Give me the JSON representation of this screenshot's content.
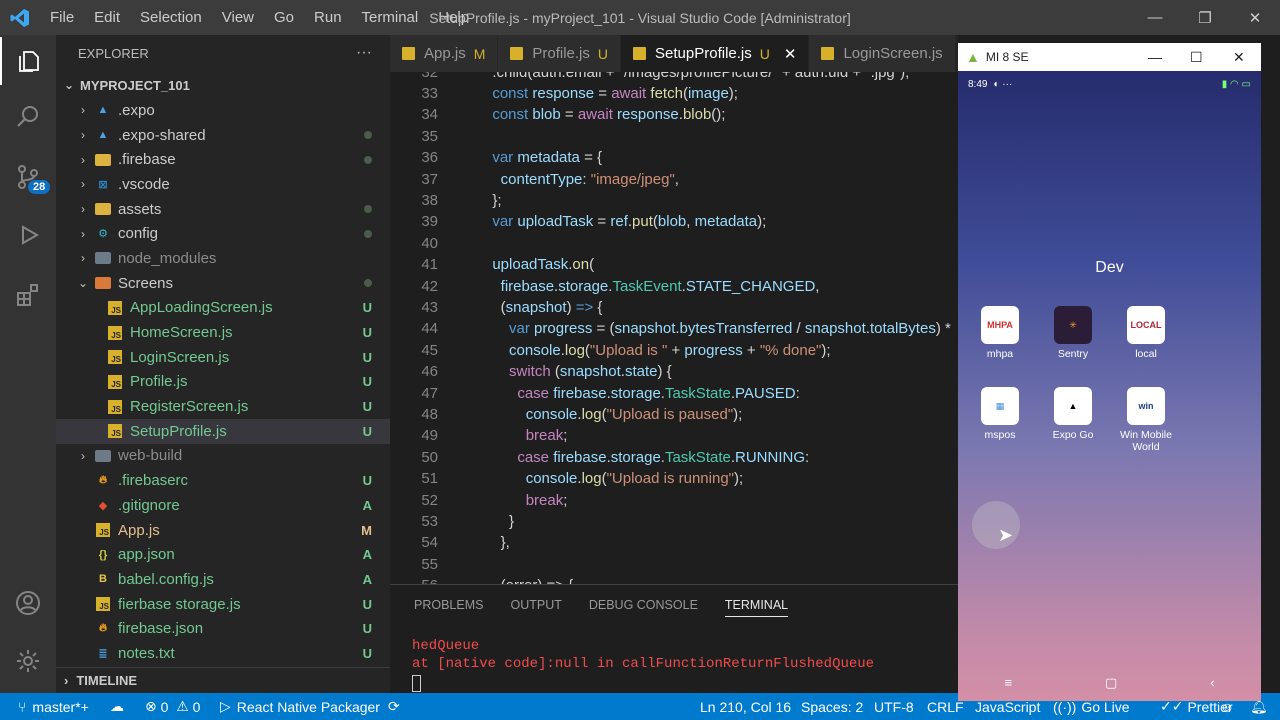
{
  "window": {
    "title": "SetupProfile.js - myProject_101 - Visual Studio Code [Administrator]"
  },
  "menu": [
    "File",
    "Edit",
    "Selection",
    "View",
    "Go",
    "Run",
    "Terminal",
    "Help"
  ],
  "activity": {
    "scm_badge": "28"
  },
  "explorer": {
    "header": "EXPLORER",
    "more": "···",
    "project": "MYPROJECT_101",
    "timeline": "TIMELINE",
    "items": [
      {
        "name": ".expo",
        "status": "",
        "icon": "expo",
        "depth": 1,
        "chev": "›"
      },
      {
        "name": ".expo-shared",
        "status": "dot",
        "icon": "expo",
        "depth": 1,
        "chev": "›"
      },
      {
        "name": ".firebase",
        "status": "dot",
        "icon": "folder-y",
        "depth": 1,
        "chev": "›"
      },
      {
        "name": ".vscode",
        "status": "",
        "icon": "vscode",
        "depth": 1,
        "chev": "›"
      },
      {
        "name": "assets",
        "status": "dot",
        "icon": "folder-y",
        "depth": 1,
        "chev": "›"
      },
      {
        "name": "config",
        "status": "dot",
        "icon": "config",
        "depth": 1,
        "chev": "›"
      },
      {
        "name": "node_modules",
        "status": "",
        "icon": "folder-g",
        "depth": 1,
        "chev": "›"
      },
      {
        "name": "Screens",
        "status": "dot",
        "icon": "folder-o",
        "depth": 1,
        "chev": "⌄"
      },
      {
        "name": "AppLoadingScreen.js",
        "status": "U",
        "icon": "js",
        "depth": 2,
        "chev": ""
      },
      {
        "name": "HomeScreen.js",
        "status": "U",
        "icon": "js",
        "depth": 2,
        "chev": ""
      },
      {
        "name": "LoginScreen.js",
        "status": "U",
        "icon": "js",
        "depth": 2,
        "chev": ""
      },
      {
        "name": "Profile.js",
        "status": "U",
        "icon": "js",
        "depth": 2,
        "chev": ""
      },
      {
        "name": "RegisterScreen.js",
        "status": "U",
        "icon": "js",
        "depth": 2,
        "chev": ""
      },
      {
        "name": "SetupProfile.js",
        "status": "U",
        "icon": "js",
        "depth": 2,
        "chev": "",
        "selected": true
      },
      {
        "name": "web-build",
        "status": "",
        "icon": "folder-g",
        "depth": 1,
        "chev": "›"
      },
      {
        "name": ".firebaserc",
        "status": "U",
        "icon": "fire",
        "depth": 1,
        "chev": ""
      },
      {
        "name": ".gitignore",
        "status": "A",
        "icon": "git",
        "depth": 1,
        "chev": ""
      },
      {
        "name": "App.js",
        "status": "M",
        "icon": "js",
        "depth": 1,
        "chev": ""
      },
      {
        "name": "app.json",
        "status": "A",
        "icon": "json",
        "depth": 1,
        "chev": ""
      },
      {
        "name": "babel.config.js",
        "status": "A",
        "icon": "babel",
        "depth": 1,
        "chev": ""
      },
      {
        "name": "fierbase storage.js",
        "status": "U",
        "icon": "js",
        "depth": 1,
        "chev": ""
      },
      {
        "name": "firebase.json",
        "status": "U",
        "icon": "fire",
        "depth": 1,
        "chev": ""
      },
      {
        "name": "notes.txt",
        "status": "U",
        "icon": "txt",
        "depth": 1,
        "chev": ""
      }
    ]
  },
  "tabs": [
    {
      "label": "App.js",
      "mod": "M",
      "active": false
    },
    {
      "label": "Profile.js",
      "mod": "U",
      "active": false
    },
    {
      "label": "SetupProfile.js",
      "mod": "U",
      "active": true,
      "close": "✕"
    },
    {
      "label": "LoginScreen.js",
      "mod": "",
      "active": false
    }
  ],
  "code": {
    "partial_top": "  .child(auth.email + \"/images/profilePicture/\" + auth.uid + \".jpg\");",
    "lines": [
      {
        "n": "33",
        "html": "  <span class='kw'>const</span> <span class='vr'>response</span> = <span class='k2'>await</span> <span class='fn'>fetch</span>(<span class='vr'>image</span>);"
      },
      {
        "n": "34",
        "html": "  <span class='kw'>const</span> <span class='vr'>blob</span> = <span class='k2'>await</span> <span class='vr'>response</span>.<span class='fn'>blob</span>();"
      },
      {
        "n": "35",
        "html": ""
      },
      {
        "n": "36",
        "html": "  <span class='kw'>var</span> <span class='vr'>metadata</span> = {"
      },
      {
        "n": "37",
        "html": "    <span class='vr'>contentType</span>: <span class='str'>\"image/jpeg\"</span>,"
      },
      {
        "n": "38",
        "html": "  };"
      },
      {
        "n": "39",
        "html": "  <span class='kw'>var</span> <span class='vr'>uploadTask</span> = <span class='vr'>ref</span>.<span class='fn'>put</span>(<span class='vr'>blob</span>, <span class='vr'>metadata</span>);"
      },
      {
        "n": "40",
        "html": ""
      },
      {
        "n": "41",
        "html": "  <span class='vr'>uploadTask</span>.<span class='fn'>on</span>("
      },
      {
        "n": "42",
        "html": "    <span class='vr'>firebase</span>.<span class='vr'>storage</span>.<span class='ty'>TaskEvent</span>.<span class='vr'>STATE_CHANGED</span>,"
      },
      {
        "n": "43",
        "html": "    (<span class='vr'>snapshot</span>) <span class='kw'>=&gt;</span> {"
      },
      {
        "n": "44",
        "html": "      <span class='kw'>var</span> <span class='vr'>progress</span> = (<span class='vr'>snapshot</span>.<span class='vr'>bytesTransferred</span> / <span class='vr'>snapshot</span>.<span class='vr'>totalBytes</span>) *"
      },
      {
        "n": "45",
        "html": "      <span class='vr'>console</span>.<span class='fn'>log</span>(<span class='str'>\"Upload is \"</span> + <span class='vr'>progress</span> + <span class='str'>\"% done\"</span>);"
      },
      {
        "n": "46",
        "html": "      <span class='k2'>switch</span> (<span class='vr'>snapshot</span>.<span class='vr'>state</span>) {"
      },
      {
        "n": "47",
        "html": "        <span class='k2'>case</span> <span class='vr'>firebase</span>.<span class='vr'>storage</span>.<span class='ty'>TaskState</span>.<span class='vr'>PAUSED</span>:"
      },
      {
        "n": "48",
        "html": "          <span class='vr'>console</span>.<span class='fn'>log</span>(<span class='str'>\"Upload is paused\"</span>);"
      },
      {
        "n": "49",
        "html": "          <span class='k2'>break</span>;"
      },
      {
        "n": "50",
        "html": "        <span class='k2'>case</span> <span class='vr'>firebase</span>.<span class='vr'>storage</span>.<span class='ty'>TaskState</span>.<span class='vr'>RUNNING</span>:"
      },
      {
        "n": "51",
        "html": "          <span class='vr'>console</span>.<span class='fn'>log</span>(<span class='str'>\"Upload is running\"</span>);"
      },
      {
        "n": "52",
        "html": "          <span class='k2'>break</span>;"
      },
      {
        "n": "53",
        "html": "      }"
      },
      {
        "n": "54",
        "html": "    },"
      },
      {
        "n": "55",
        "html": ""
      }
    ]
  },
  "panel": {
    "tabs": [
      "PROBLEMS",
      "OUTPUT",
      "DEBUG CONSOLE",
      "TERMINAL"
    ],
    "active": "TERMINAL",
    "terminal": [
      "hedQueue",
      "at [native code]:null in callFunctionReturnFlushedQueue"
    ]
  },
  "status": {
    "branch": "master*+",
    "errors": "0",
    "warnings": "0",
    "packager": "React Native Packager",
    "position": "Ln 210, Col 16",
    "spaces": "Spaces: 2",
    "encoding": "UTF-8",
    "eol": "CRLF",
    "language": "JavaScript",
    "golive": "Go Live",
    "prettier": "Prettier"
  },
  "phone": {
    "title": "MI 8 SE",
    "time": "8:49",
    "folder": "Dev",
    "apps": [
      {
        "name": "mhpa",
        "icon_text": "MHPA",
        "color": "#d32f2f"
      },
      {
        "name": "Sentry",
        "icon_text": "✳",
        "color": "#f0a020"
      },
      {
        "name": "local",
        "icon_text": "LOCAL",
        "color": "#b0243a"
      },
      {
        "name": "mspos",
        "icon_text": "▦",
        "color": "#3b8fd8"
      },
      {
        "name": "Expo Go",
        "icon_text": "▲",
        "color": "#000"
      },
      {
        "name": "Win Mobile World",
        "icon_text": "win",
        "color": "#1a3f8a"
      }
    ]
  }
}
